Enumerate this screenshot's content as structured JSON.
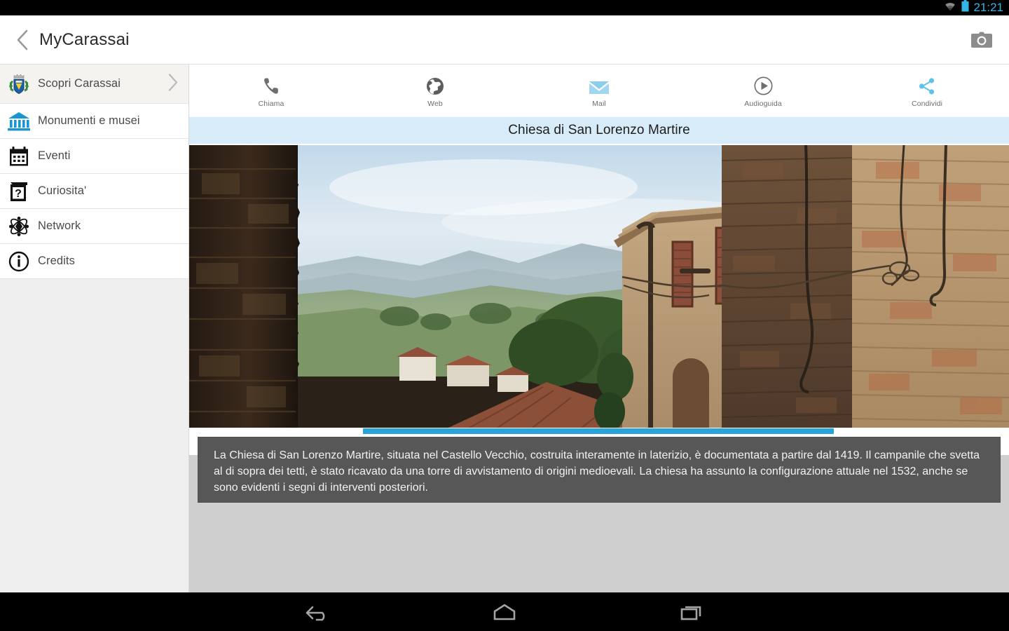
{
  "statusbar": {
    "time": "21:21",
    "icons": [
      "wifi-icon",
      "battery-icon"
    ]
  },
  "actionbar": {
    "back_icon": "back-chevron-icon",
    "title": "MyCarassai",
    "camera_icon": "camera-icon"
  },
  "sidebar": {
    "items": [
      {
        "label": "Scopri Carassai",
        "icon": "coat-of-arms-icon",
        "selected": true,
        "chevron": "chevron-right-icon"
      },
      {
        "label": "Monumenti e musei",
        "icon": "museum-icon",
        "selected": false
      },
      {
        "label": "Eventi",
        "icon": "calendar-icon",
        "selected": false
      },
      {
        "label": "Curiosita'",
        "icon": "question-book-icon",
        "selected": false
      },
      {
        "label": "Network",
        "icon": "atom-network-icon",
        "selected": false
      },
      {
        "label": "Credits",
        "icon": "info-circle-icon",
        "selected": false
      }
    ]
  },
  "main": {
    "actions": [
      {
        "label": "Chiama",
        "icon": "phone-icon"
      },
      {
        "label": "Web",
        "icon": "globe-icon"
      },
      {
        "label": "Mail",
        "icon": "mail-icon"
      },
      {
        "label": "Audioguida",
        "icon": "play-circle-icon"
      },
      {
        "label": "Condividi",
        "icon": "share-icon"
      }
    ],
    "place_title": "Chiesa di San Lorenzo Martire",
    "photo_alt": "brick-church-view-photo",
    "gallery_indicator": "gallery-scroll-indicator",
    "description": "La Chiesa di San Lorenzo Martire, situata nel Castello Vecchio, costruita interamente in laterizio, è documentata a partire dal 1419. Il campanile che svetta al di sopra dei tetti,  è stato ricavato da una torre di avvistamento di origini medioevali. La chiesa ha assunto la configurazione attuale nel 1532, anche se sono evidenti i segni di interventi posteriori."
  },
  "navbar": {
    "buttons": [
      {
        "icon": "back-arrow-icon",
        "label": "Back"
      },
      {
        "icon": "home-icon",
        "label": "Home"
      },
      {
        "icon": "recents-icon",
        "label": "Recent apps"
      }
    ]
  },
  "colors": {
    "accent_blue": "#29a3d8",
    "title_band": "#d7ecf8",
    "status_clock": "#33b5e5",
    "desc_bg": "#575757"
  }
}
